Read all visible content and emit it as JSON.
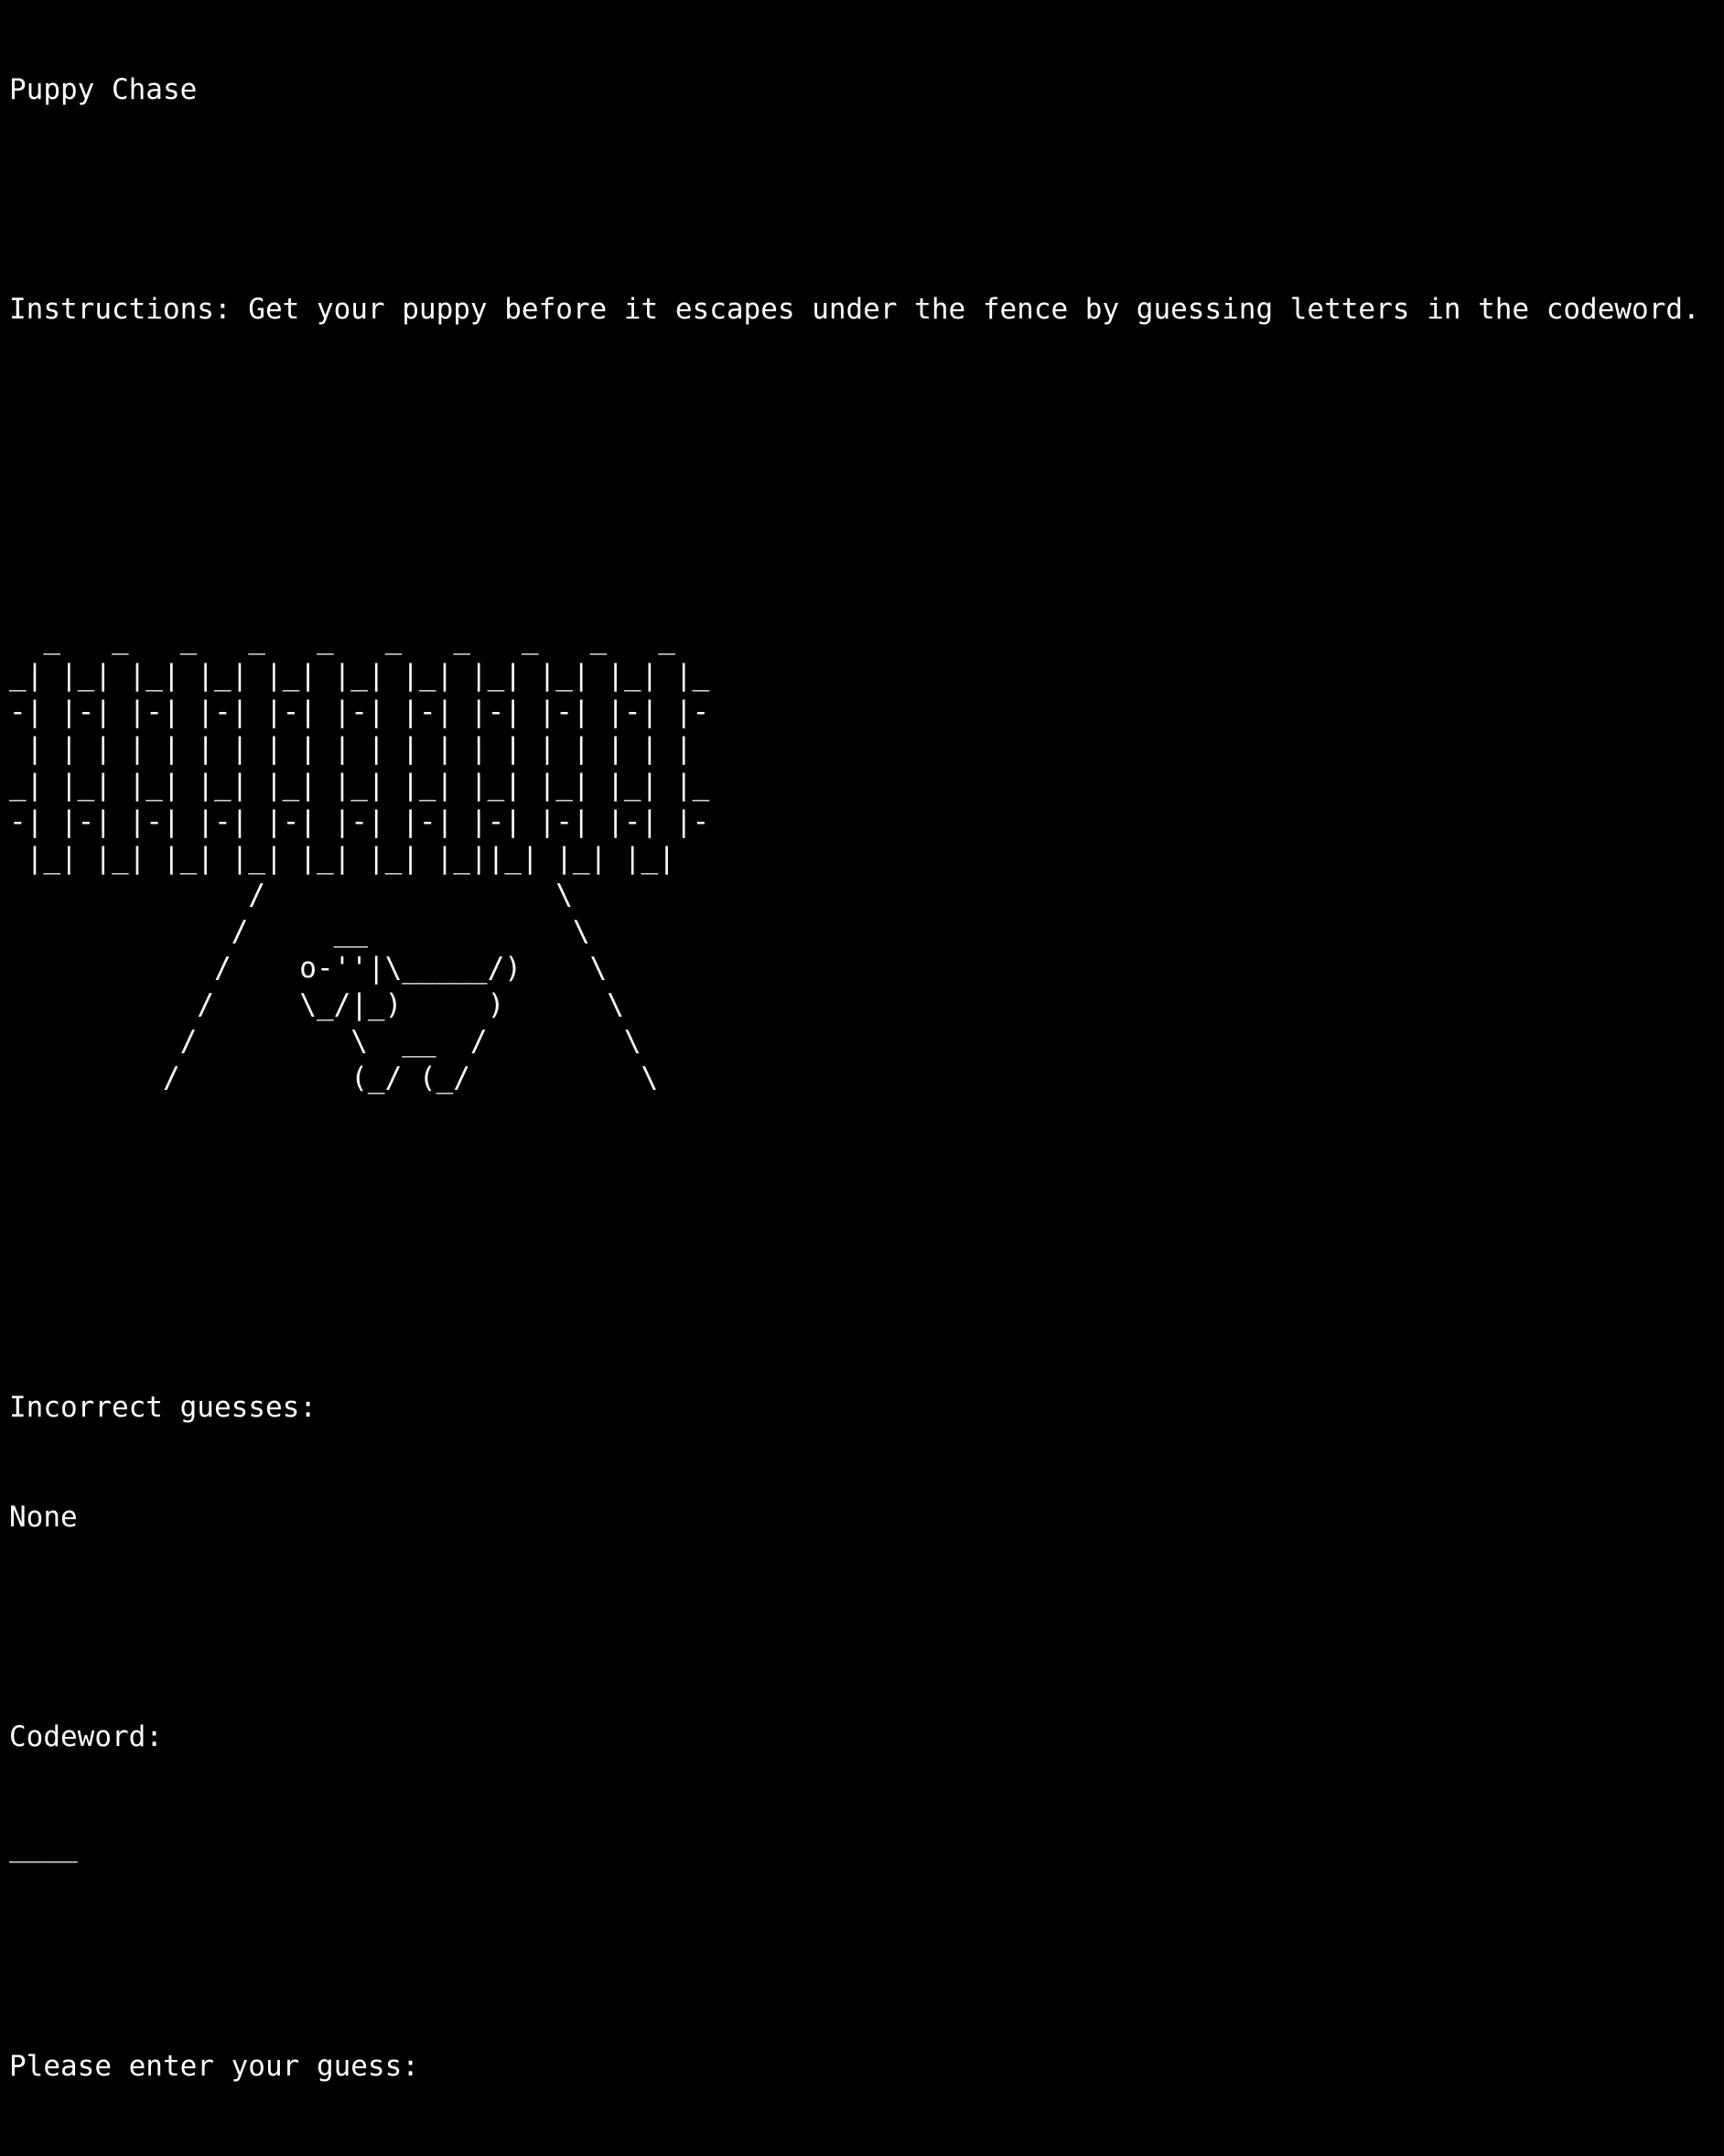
{
  "app": {
    "title": "Puppy Chase",
    "instructions": "Instructions: Get your puppy before it escapes under the fence by guessing letters in the codeword."
  },
  "art": {
    "fence_and_puppy": "  _   _   _   _   _   _   _   _   _   _\n_| |_| |_| |_| |_| |_| |_| |_| |_| |_| |_\n-| |-| |-| |-| |-| |-| |-| |-| |-| |-| |-\n | | | | | | | | | | | | | | | | | | | |\n_| |_| |_| |_| |_| |_| |_| |_| |_| |_| |_\n-| |-| |-| |-| |-| |-| |-| |-| |-| |-| |-\n |_| |_| |_| |_| |_| |_| |_||_| |_| |_|\n              /                 \\\n             /     __            \\\n            /    o-''|\\_____/)    \\\n           /     \\_/|_)     )      \\\n          /         \\  __  /        \\\n         /          (_/ (_/          \\"
  },
  "status": {
    "incorrect_label": "Incorrect guesses:",
    "incorrect_value": "None",
    "codeword_label": "Codeword:",
    "codeword_value": "____",
    "prompt": "Please enter your guess:"
  }
}
